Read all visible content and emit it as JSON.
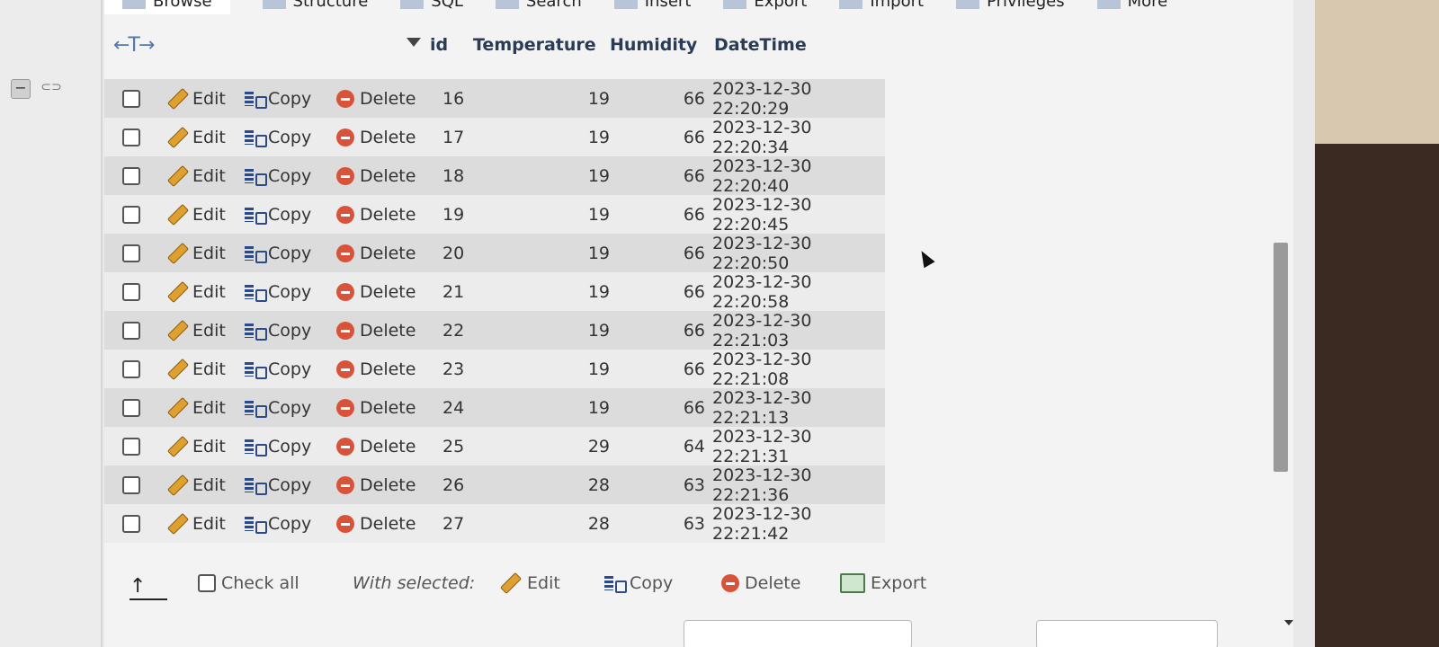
{
  "tabs": [
    {
      "label": "Browse",
      "icon": "browse-icon"
    },
    {
      "label": "Structure",
      "icon": "structure-icon"
    },
    {
      "label": "SQL",
      "icon": "sql-icon"
    },
    {
      "label": "Search",
      "icon": "search-icon"
    },
    {
      "label": "Insert",
      "icon": "insert-icon"
    },
    {
      "label": "Export",
      "icon": "export-icon"
    },
    {
      "label": "Import",
      "icon": "import-icon"
    },
    {
      "label": "Privileges",
      "icon": "privileges-icon"
    },
    {
      "label": "More",
      "icon": "chevron-down-icon"
    }
  ],
  "table": {
    "arrows_label": "←T→",
    "columns": [
      "id",
      "Temperature",
      "Humidity",
      "DateTime"
    ],
    "action_labels": {
      "edit": "Edit",
      "copy": "Copy",
      "delete": "Delete"
    },
    "rows": [
      {
        "id": "16",
        "temperature": "19",
        "humidity": "66",
        "datetime": "2023-12-30 22:20:29"
      },
      {
        "id": "17",
        "temperature": "19",
        "humidity": "66",
        "datetime": "2023-12-30 22:20:34"
      },
      {
        "id": "18",
        "temperature": "19",
        "humidity": "66",
        "datetime": "2023-12-30 22:20:40"
      },
      {
        "id": "19",
        "temperature": "19",
        "humidity": "66",
        "datetime": "2023-12-30 22:20:45"
      },
      {
        "id": "20",
        "temperature": "19",
        "humidity": "66",
        "datetime": "2023-12-30 22:20:50"
      },
      {
        "id": "21",
        "temperature": "19",
        "humidity": "66",
        "datetime": "2023-12-30 22:20:58"
      },
      {
        "id": "22",
        "temperature": "19",
        "humidity": "66",
        "datetime": "2023-12-30 22:21:03"
      },
      {
        "id": "23",
        "temperature": "19",
        "humidity": "66",
        "datetime": "2023-12-30 22:21:08"
      },
      {
        "id": "24",
        "temperature": "19",
        "humidity": "66",
        "datetime": "2023-12-30 22:21:13"
      },
      {
        "id": "25",
        "temperature": "29",
        "humidity": "64",
        "datetime": "2023-12-30 22:21:31"
      },
      {
        "id": "26",
        "temperature": "28",
        "humidity": "63",
        "datetime": "2023-12-30 22:21:36"
      },
      {
        "id": "27",
        "temperature": "28",
        "humidity": "63",
        "datetime": "2023-12-30 22:21:42"
      }
    ]
  },
  "footer": {
    "check_all": "Check all",
    "with_selected": "With selected:",
    "edit": "Edit",
    "copy": "Copy",
    "delete": "Delete",
    "export": "Export"
  },
  "bottom_select": {
    "value": "None"
  }
}
